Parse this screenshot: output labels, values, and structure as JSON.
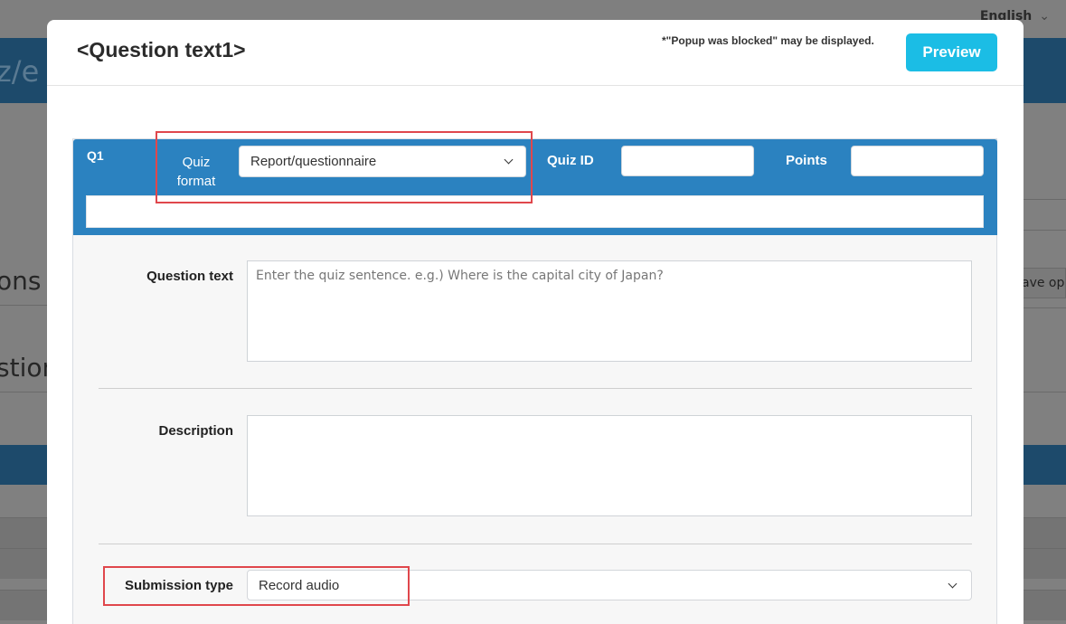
{
  "background": {
    "language": "English",
    "header_fragment": "z/e",
    "left_fragment_1": "ons",
    "left_fragment_2": "stion",
    "right_fragment": "ave op"
  },
  "modal": {
    "title": "<Question text1>",
    "popup_note": "*\"Popup was blocked\" may be displayed.",
    "preview_label": "Preview"
  },
  "question": {
    "number": "Q1",
    "format_label": "Quiz format",
    "format_value": "Report/questionnaire",
    "quiz_id_label": "Quiz ID",
    "quiz_id_value": "",
    "points_label": "Points",
    "points_value": "",
    "question_text_label": "Question text",
    "question_text_placeholder": "Enter the quiz sentence. e.g.) Where is the capital city of Japan?",
    "description_label": "Description",
    "description_value": "",
    "submission_type_label": "Submission type",
    "submission_type_value": "Record audio"
  },
  "colors": {
    "header_blue": "#2b82c0",
    "preview_button": "#1bbde5",
    "highlight_red": "#e0474c"
  }
}
